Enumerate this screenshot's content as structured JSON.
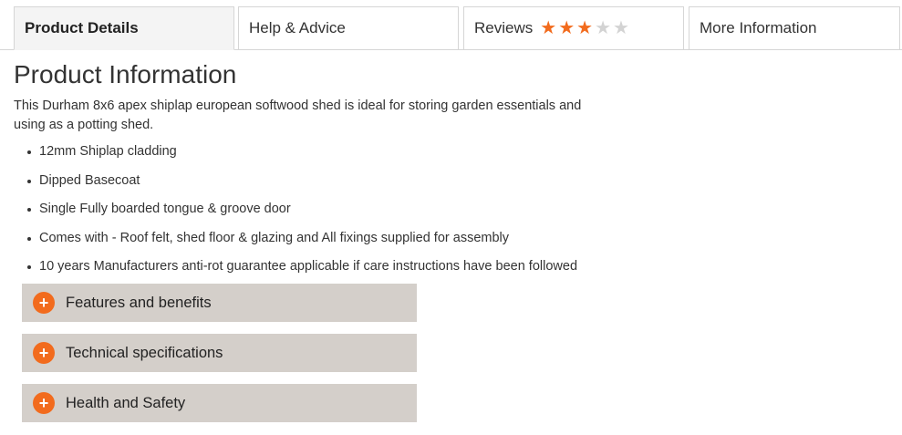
{
  "tabs": [
    {
      "label": "Product Details",
      "active": true
    },
    {
      "label": "Help & Advice",
      "active": false
    },
    {
      "label": "Reviews",
      "active": false,
      "rating": 3,
      "rating_max": 5
    },
    {
      "label": "More Information",
      "active": false
    }
  ],
  "product_info": {
    "title": "Product Information",
    "description": "This Durham 8x6 apex shiplap european softwood shed is ideal for storing garden essentials and using as a potting shed.",
    "features": [
      "12mm Shiplap cladding",
      "Dipped Basecoat",
      "Single Fully boarded tongue & groove door",
      "Comes with - Roof felt, shed floor & glazing and All fixings supplied for assembly",
      "10 years Manufacturers anti-rot guarantee applicable if care instructions have been followed"
    ]
  },
  "accordions": [
    {
      "label": "Features and benefits",
      "icon": "plus-icon"
    },
    {
      "label": "Technical specifications",
      "icon": "plus-icon"
    },
    {
      "label": "Health and Safety",
      "icon": "plus-icon"
    }
  ],
  "colors": {
    "accent": "#f26b1d",
    "accordion_bg": "#d4cfca",
    "star_off": "#d3d3d3",
    "border": "#d6d6d6"
  }
}
